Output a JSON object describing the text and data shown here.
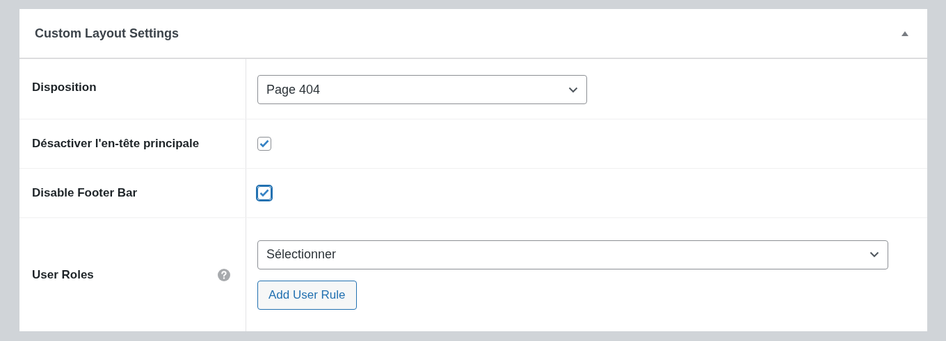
{
  "panel": {
    "title": "Custom Layout Settings",
    "expanded": true
  },
  "rows": [
    {
      "kind": "select",
      "label": "Disposition",
      "value": "Page 404"
    },
    {
      "kind": "checkbox",
      "label": "Désactiver l'en-tête principale",
      "checked": true,
      "focused": false
    },
    {
      "kind": "checkbox",
      "label": "Disable Footer Bar",
      "checked": true,
      "focused": true
    },
    {
      "kind": "rules",
      "label": "User Roles",
      "value": "Sélectionner",
      "button": "Add User Rule"
    }
  ]
}
